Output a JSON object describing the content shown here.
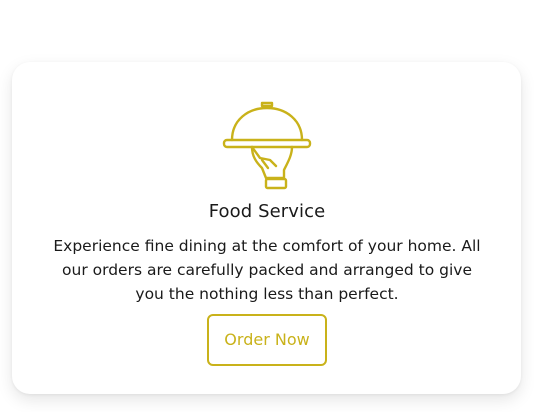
{
  "card": {
    "icon": "cloche-serving-hand-icon",
    "title": "Food Service",
    "description": "Experience fine dining at the comfort of your home. All our orders are carefully packed and arranged to give you the nothing less than perfect.",
    "button_label": "Order Now"
  },
  "colors": {
    "accent": "#c9b21a",
    "text": "#1a1a1a",
    "background": "#ffffff"
  }
}
